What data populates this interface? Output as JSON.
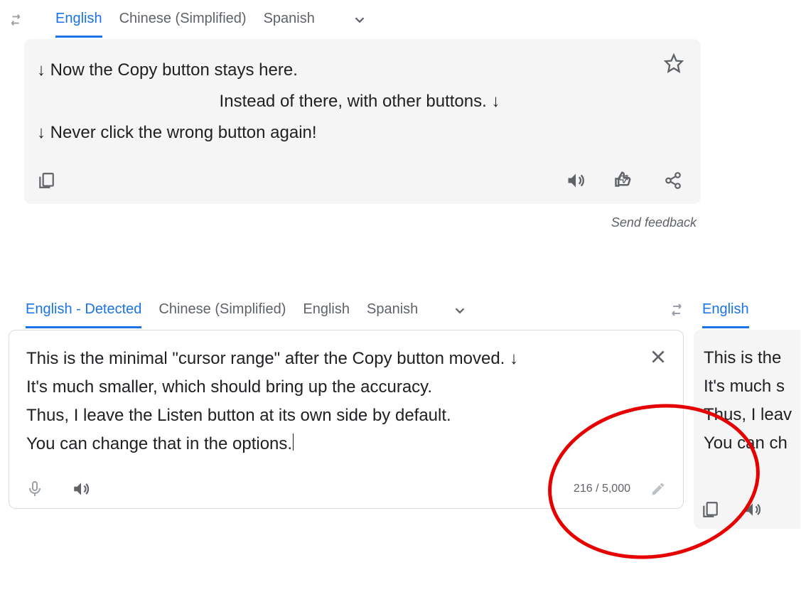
{
  "top": {
    "tabs": [
      "English",
      "Chinese (Simplified)",
      "Spanish"
    ],
    "active_index": 0,
    "lines": {
      "l1": "↓ Now the Copy button stays here.",
      "l2": "Instead of there, with other buttons. ↓",
      "l3": "↓ Never click the wrong button again!"
    },
    "feedback": "Send feedback"
  },
  "src": {
    "tabs": [
      "English - Detected",
      "Chinese (Simplified)",
      "English",
      "Spanish"
    ],
    "active_index": 0,
    "text": {
      "l1": "This is the minimal \"cursor range\" after the Copy button moved. ↓",
      "l2": "It's much smaller, which should bring up the accuracy.",
      "l3": "Thus, I leave the Listen button at its own side by default.",
      "l4": "You can change that in the options."
    },
    "charcount": "216 / 5,000"
  },
  "tgt": {
    "tabs": [
      "English"
    ],
    "active_index": 0,
    "text": {
      "l1": "This is the",
      "l2": "It's much s",
      "l3": "Thus, I leav",
      "l4": "You can ch"
    }
  },
  "icons": {
    "swap": "swap-icon",
    "chevron": "chevron-down-icon",
    "star": "star-icon",
    "copy": "copy-icon",
    "speaker": "speaker-icon",
    "thumbs": "thumbs-icon",
    "share": "share-icon",
    "mic": "mic-icon",
    "close": "close-icon",
    "pencil": "pencil-icon"
  }
}
